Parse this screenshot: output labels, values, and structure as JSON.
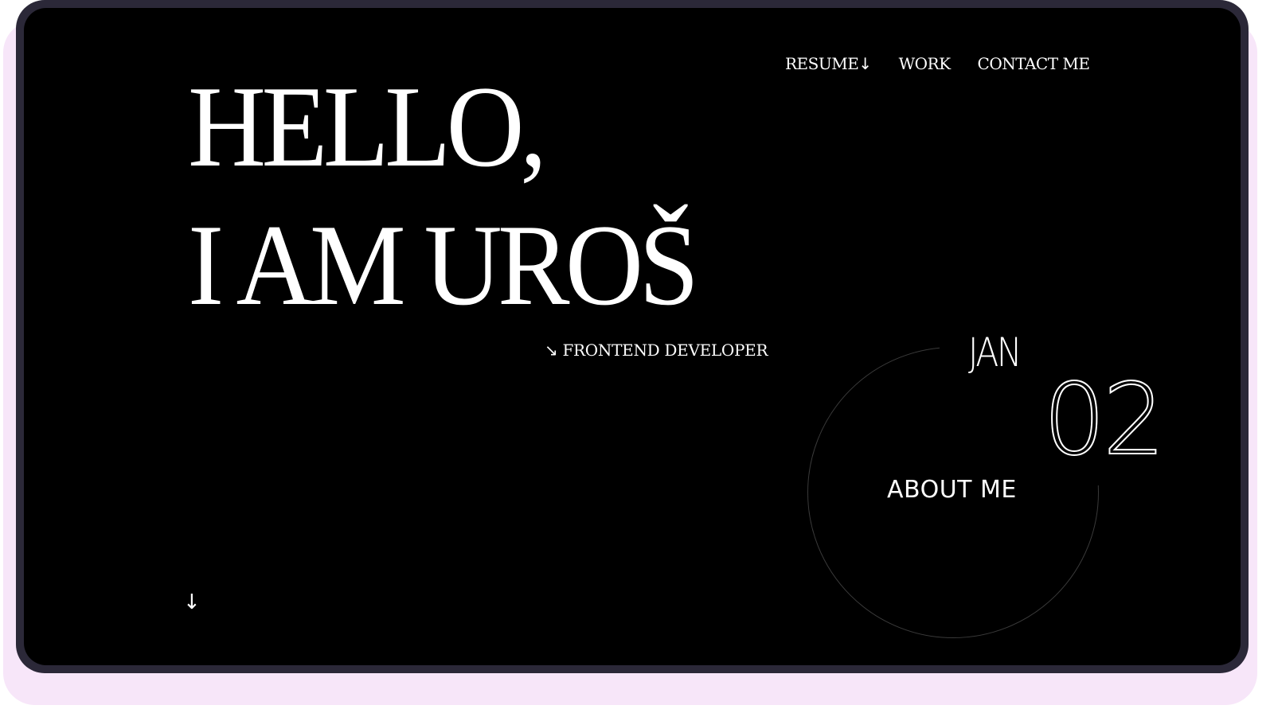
{
  "nav": {
    "items": [
      {
        "label": "RESUME",
        "icon": "arrow-down-icon",
        "icon_glyph": "↓"
      },
      {
        "label": "WORK"
      },
      {
        "label": "CONTACT ME"
      }
    ]
  },
  "hero": {
    "line1": "HELLO,",
    "line2": "I AM UROŠ"
  },
  "subtitle": {
    "icon": "arrow-down-right-icon",
    "icon_glyph": "↘",
    "text": "FRONTEND DEVELOPER"
  },
  "scroll": {
    "icon": "arrow-down-icon",
    "glyph": "↓"
  },
  "date": {
    "month": "JAN",
    "day": "02"
  },
  "about": {
    "label": "ABOUT ME"
  },
  "colors": {
    "background": "#000000",
    "text": "#ffffff",
    "frame": "#2b2838",
    "frame_shadow": "#f7e6f9"
  }
}
